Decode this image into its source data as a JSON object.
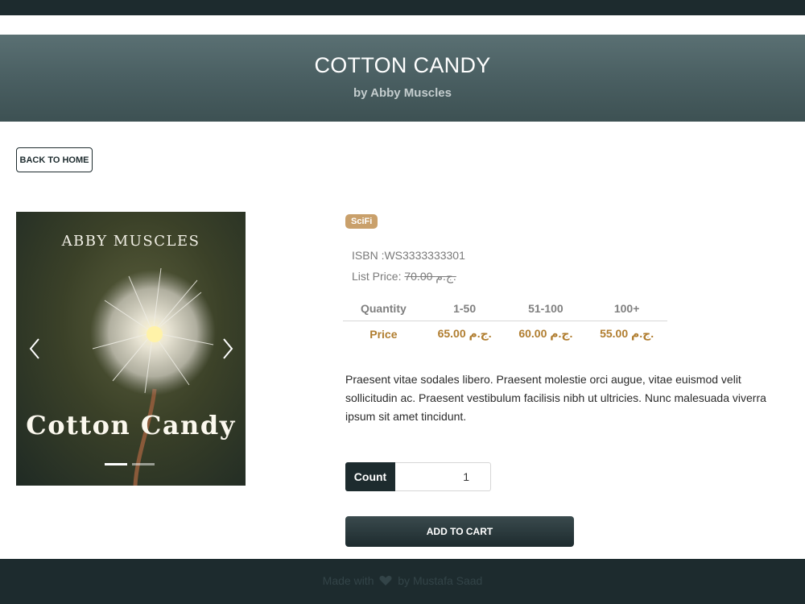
{
  "banner": {
    "title": "COTTON CANDY",
    "author": "by Abby Muscles"
  },
  "nav": {
    "back_label": "BACK TO HOME"
  },
  "carousel": {
    "cover_author": "ABBY MUSCLES",
    "cover_title": "Cotton Candy",
    "slide_count": 2,
    "active_slide": 1
  },
  "product": {
    "category_badge": "SciFi",
    "isbn_text": "ISBN :WS3333333301",
    "list_price_label": "List Price: ",
    "list_price_value": "70.00 ج.م.",
    "price_table": {
      "row_header_quantity": "Quantity",
      "row_header_price": "Price",
      "columns": [
        "1-50",
        "51-100",
        "100+"
      ],
      "prices": [
        "65.00 ج.م.",
        "60.00 ج.م.",
        "55.00 ج.م."
      ]
    },
    "description_lines": [
      "Praesent vitae sodales libero. Praesent molestie orci augue, vitae euismod velit",
      "sollicitudin ac. Praesent vestibulum facilisis nibh ut ultricies. Nunc malesuada viverra",
      "ipsum sit amet tincidunt."
    ],
    "count_label": "Count",
    "count_value": "1",
    "add_to_cart_label": "ADD TO CART"
  },
  "footer": {
    "made_with": "Made with",
    "by_text": "by Mustafa Saad"
  },
  "colors": {
    "dark": "#1d2b2e",
    "badge": "#c9a06b",
    "price": "#b07d2f"
  },
  "icons": {
    "prev": "chevron-left-icon",
    "next": "chevron-right-icon",
    "heart": "heart-icon"
  }
}
